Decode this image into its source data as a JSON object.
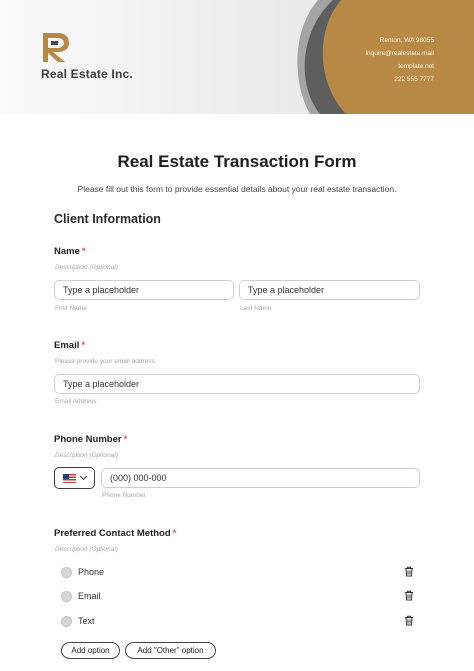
{
  "header": {
    "brand": "Real Estate Inc.",
    "contact_lines": [
      "Renton, WA 98055",
      "inquire@realestate.mail",
      "template.net",
      "222 555 7777"
    ],
    "colors": {
      "gold": "#b88945",
      "dark": "#4d4d4d"
    }
  },
  "form": {
    "title": "Real Estate Transaction Form",
    "description": "Please fill out this form to provide essential details about your real estate transaction.",
    "section_title": "Client Information"
  },
  "name_field": {
    "label": "Name",
    "required_mark": "*",
    "hint": "Description (Optional)",
    "first_placeholder": "Type a placeholder",
    "last_placeholder": "Type a placeholder",
    "first_sublabel": "First Name",
    "last_sublabel": "Last Name"
  },
  "email_field": {
    "label": "Email",
    "required_mark": "*",
    "hint": "Please provide your email address.",
    "placeholder": "Type a placeholder",
    "sublabel": "Email Address"
  },
  "phone_field": {
    "label": "Phone Number",
    "required_mark": "*",
    "hint": "Description (Optional)",
    "country_flag": "us-flag-icon",
    "placeholder": "(000) 000-000",
    "sublabel": "Phone Number"
  },
  "contact_method": {
    "label": "Preferred Contact Method",
    "required_mark": "*",
    "hint": "Description (Optional)",
    "options": [
      {
        "label": "Phone"
      },
      {
        "label": "Email"
      },
      {
        "label": "Text"
      }
    ],
    "add_option_label": "Add option",
    "add_other_label": "Add \"Other\" option"
  }
}
